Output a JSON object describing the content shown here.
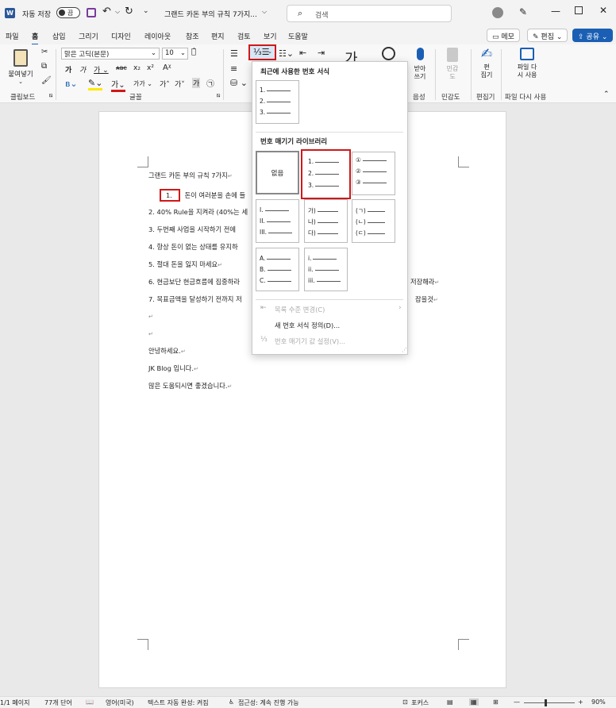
{
  "titlebar": {
    "autosave_label": "자동 저장",
    "autosave_state": "끔",
    "doc_title": "그랜드 카돈 부의 규칙 7가지...",
    "search_placeholder": "검색"
  },
  "tabs": [
    "파일",
    "홈",
    "삽입",
    "그리기",
    "디자인",
    "레이아웃",
    "참조",
    "편지",
    "검토",
    "보기",
    "도움말"
  ],
  "top_buttons": {
    "memo": "메모",
    "edit": "편집",
    "share": "공유"
  },
  "ribbon": {
    "paste_label": "붙여넣기",
    "font_name": "맑은 고딕(본문)",
    "font_size": "10",
    "groups": {
      "clipboard": "클립보드",
      "font": "글꼴",
      "voice": "음성",
      "sensitivity": "민감도",
      "editor": "편집기",
      "reuse": "파일 다시 사용"
    },
    "dictate": "받아\n쓰기",
    "sensitivity_btn": "민감\n도",
    "editor_btn": "편\n집기",
    "reuse_btn": "파일 다\n시 사용",
    "style_glyph": "가"
  },
  "dropdown": {
    "recent_title": "최근에 사용한 번호 서식",
    "library_title": "번호 매기기 라이브러리",
    "none_label": "없음",
    "recent_tile": [
      "1.",
      "2.",
      "3."
    ],
    "tiles": [
      [
        "1.",
        "2.",
        "3."
      ],
      [
        "①",
        "②",
        "③"
      ],
      [
        "I.",
        "II.",
        "III."
      ],
      [
        "가)",
        "나)",
        "다)"
      ],
      [
        "(ㄱ)",
        "(ㄴ)",
        "(ㄷ)"
      ],
      [
        "A.",
        "B.",
        "C."
      ],
      [
        "i.",
        "ii.",
        "iii."
      ]
    ],
    "menu": {
      "change_level": "목록 수준 변경(C)",
      "define_new": "새 번호 서식 정의(D)...",
      "set_value": "번호 매기기 값 설정(V)..."
    }
  },
  "document": {
    "lines": [
      "그랜드 카돈 부의 규칙 7가지",
      "돈이 여러분을 손에 들",
      "2. 40% Rule을 지켜라 (40%는 세",
      "3. 두번째 사업을 시작하기 전에",
      "4. 항상 돈이 없는 상태를 유지하",
      "5. 절대 돈을 잃지 마세요",
      "6. 현금보단 현금흐름에 집중하라",
      "7. 목표금액을 달성하기 전까지 저",
      "",
      "",
      "안녕하세요.",
      "JK Blog 입니다.",
      "많은 도움되시면 좋겠습니다."
    ],
    "list_number": "1.",
    "line6_tail": "저장해라",
    "line7_tail": "잡을것"
  },
  "statusbar": {
    "page": "1/1 페이지",
    "words": "77개 단어",
    "language": "영어(미국)",
    "autocomplete": "텍스트 자동 완성: 켜짐",
    "accessibility": "접근성: 계속 진행 가능",
    "focus": "포커스",
    "zoom": "90%"
  }
}
